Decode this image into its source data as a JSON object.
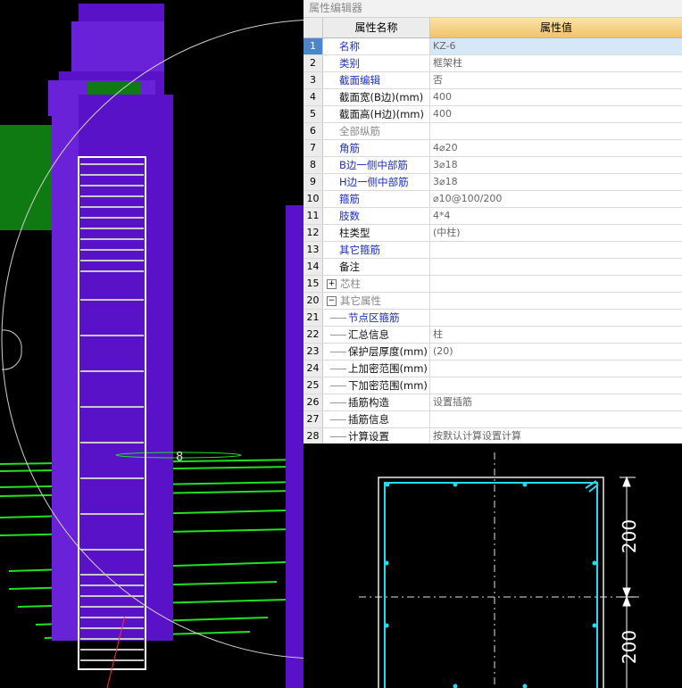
{
  "panel": {
    "title": "属性编辑器",
    "header": {
      "name_col": "属性名称",
      "value_col": "属性值"
    }
  },
  "rows": [
    {
      "num": "1",
      "name": "名称",
      "value": "KZ-6",
      "color": "blue",
      "selected": true
    },
    {
      "num": "2",
      "name": "类别",
      "value": "框架柱",
      "color": "blue"
    },
    {
      "num": "3",
      "name": "截面编辑",
      "value": "否",
      "color": "blue"
    },
    {
      "num": "4",
      "name": "截面宽(B边)(mm)",
      "value": "400",
      "color": "black"
    },
    {
      "num": "5",
      "name": "截面高(H边)(mm)",
      "value": "400",
      "color": "black"
    },
    {
      "num": "6",
      "name": "全部纵筋",
      "value": "",
      "color": "gray"
    },
    {
      "num": "7",
      "name": "角筋",
      "value": "4⌀20",
      "color": "blue"
    },
    {
      "num": "8",
      "name": "B边一侧中部筋",
      "value": "3⌀18",
      "color": "blue"
    },
    {
      "num": "9",
      "name": "H边一侧中部筋",
      "value": "3⌀18",
      "color": "blue"
    },
    {
      "num": "10",
      "name": "箍筋",
      "value": "⌀10@100/200",
      "color": "blue"
    },
    {
      "num": "11",
      "name": "肢数",
      "value": "4*4",
      "color": "blue"
    },
    {
      "num": "12",
      "name": "柱类型",
      "value": "(中柱)",
      "color": "black"
    },
    {
      "num": "13",
      "name": "其它箍筋",
      "value": "",
      "color": "blue"
    },
    {
      "num": "14",
      "name": "备注",
      "value": "",
      "color": "black"
    },
    {
      "num": "15",
      "name": "芯柱",
      "value": "",
      "color": "gray",
      "expander": "+"
    },
    {
      "num": "20",
      "name": "其它属性",
      "value": "",
      "color": "gray",
      "expander": "−"
    },
    {
      "num": "21",
      "name": "节点区箍筋",
      "value": "",
      "color": "blue",
      "child": true
    },
    {
      "num": "22",
      "name": "汇总信息",
      "value": "柱",
      "color": "black",
      "child": true
    },
    {
      "num": "23",
      "name": "保护层厚度(mm)",
      "value": "(20)",
      "color": "black",
      "child": true
    },
    {
      "num": "24",
      "name": "上加密范围(mm)",
      "value": "",
      "color": "black",
      "child": true
    },
    {
      "num": "25",
      "name": "下加密范围(mm)",
      "value": "",
      "color": "black",
      "child": true
    },
    {
      "num": "26",
      "name": "插筋构造",
      "value": "设置插筋",
      "color": "black",
      "child": true
    },
    {
      "num": "27",
      "name": "插筋信息",
      "value": "",
      "color": "black",
      "child": true
    },
    {
      "num": "28",
      "name": "计算设置",
      "value": "按默认计算设置计算",
      "color": "black",
      "child": true
    }
  ],
  "viewport": {
    "axis_label": "8"
  },
  "section": {
    "dim_top": "200",
    "dim_bottom": "200"
  },
  "colors": {
    "column_purple": "#5a12c8",
    "slab_green": "#0f7a12",
    "rebar_green": "#22e022",
    "section_cyan": "#27d8f0",
    "header_orange": "#f0c36a",
    "selected_blue": "#4a86c8"
  }
}
